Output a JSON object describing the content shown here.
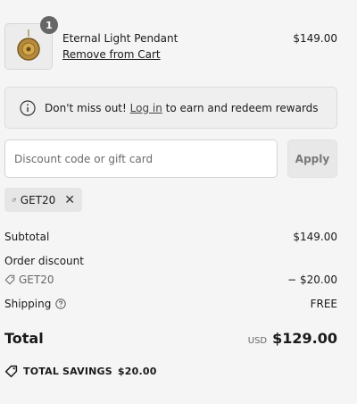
{
  "product": {
    "name": "Eternal Light Pendant",
    "remove_label": "Remove from Cart",
    "price": "$149.00",
    "quantity": "1"
  },
  "notice": {
    "prefix": "Don't miss out!",
    "login_label": "Log in",
    "suffix": "to earn and redeem rewards"
  },
  "discount": {
    "placeholder": "Discount code or gift card",
    "apply_label": "Apply",
    "applied_code": "GET20"
  },
  "summary": {
    "subtotal_label": "Subtotal",
    "subtotal_value": "$149.00",
    "order_discount_label": "Order discount",
    "discount_code": "GET20",
    "discount_value": "− $20.00",
    "shipping_label": "Shipping",
    "shipping_value": "FREE",
    "total_label": "Total",
    "currency": "USD",
    "total_value": "$129.00",
    "savings_label": "TOTAL SAVINGS",
    "savings_value": "$20.00"
  },
  "icons": {
    "info": "info-circle-icon",
    "tag": "tag-icon",
    "help": "question-circle-icon",
    "close": "close-icon"
  }
}
